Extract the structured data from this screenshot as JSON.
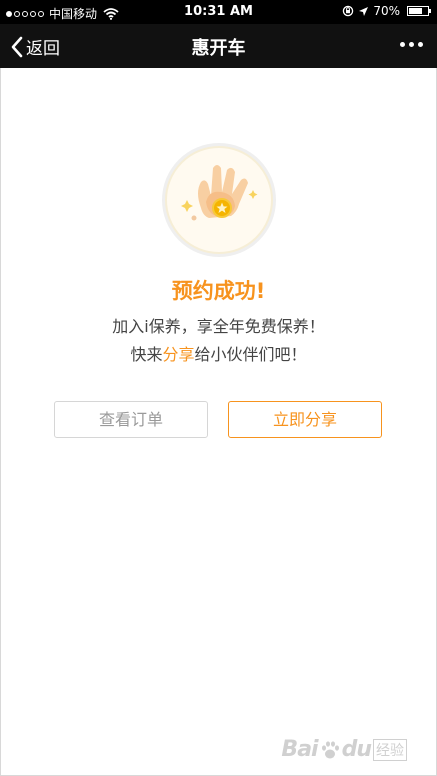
{
  "statusbar": {
    "carrier": "中国移动",
    "time": "10:31 AM",
    "battery": "70%",
    "battery_level": 0.7,
    "signal_bars": 1,
    "signal_total": 5
  },
  "nav": {
    "back_label": "返回",
    "title": "惠开车"
  },
  "result": {
    "title": "预约成功!",
    "line1": "加入i保养，享全年免费保养！",
    "line2_prefix": "快来",
    "line2_highlight": "分享",
    "line2_suffix": "给小伙伴们吧！"
  },
  "actions": {
    "order_label": "查看订单",
    "share_label": "立即分享"
  },
  "watermark": {
    "text_a": "Bai",
    "text_b": "du",
    "text_c": "经验"
  },
  "colors": {
    "accent": "#f7931e",
    "navbar": "#111111",
    "text": "#444444",
    "button_muted": "#9a9a9a"
  },
  "icons": {
    "back": "chevron-left-icon",
    "more": "more-dots-icon",
    "wifi": "wifi-icon",
    "badge": "ok-hand-coin-icon"
  }
}
